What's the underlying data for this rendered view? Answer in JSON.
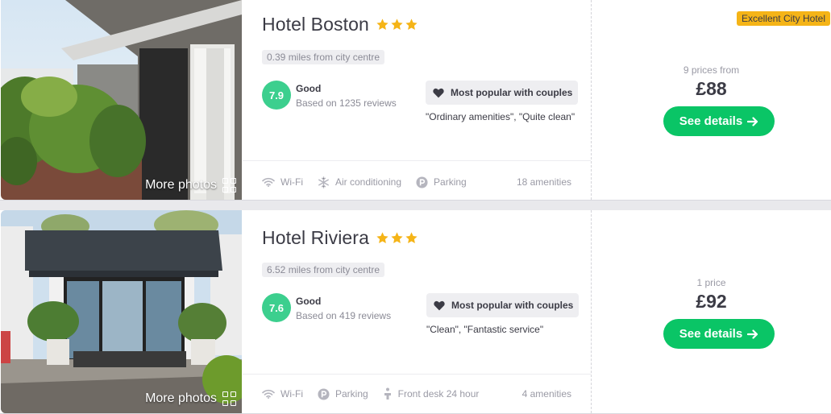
{
  "hotels": [
    {
      "name": "Hotel Boston",
      "stars": 3,
      "distance": "0.39 miles from city centre",
      "rating_score": "7.9",
      "rating_word": "Good",
      "rating_reviews": "Based on 1235 reviews",
      "popular_label": "Most popular with couples",
      "quotes": "\"Ordinary amenities\", \"Quite clean\"",
      "amenities": [
        "Wi-Fi",
        "Air conditioning",
        "Parking"
      ],
      "amenities_count": "18 amenities",
      "badge": "Excellent City Hotel",
      "prices_label": "9 prices from",
      "price": "£88",
      "details_label": "See details",
      "more_photos": "More photos"
    },
    {
      "name": "Hotel Riviera",
      "stars": 3,
      "distance": "6.52 miles from city centre",
      "rating_score": "7.6",
      "rating_word": "Good",
      "rating_reviews": "Based on 419 reviews",
      "popular_label": "Most popular with couples",
      "quotes": "\"Clean\", \"Fantastic service\"",
      "amenities": [
        "Wi-Fi",
        "Parking",
        "Front desk 24 hour"
      ],
      "amenities_count": "4 amenities",
      "prices_label": "1 price",
      "price": "£92",
      "details_label": "See details",
      "more_photos": "More photos"
    }
  ],
  "colors": {
    "rating": "#3ccf8e",
    "cta": "#0ac566",
    "badge": "#f5b417",
    "star": "#f5b417"
  },
  "icons": [
    "star-icon",
    "heart-icon",
    "wifi-icon",
    "snowflake-icon",
    "parking-icon",
    "front-desk-icon",
    "grid-icon",
    "arrow-right-icon"
  ]
}
